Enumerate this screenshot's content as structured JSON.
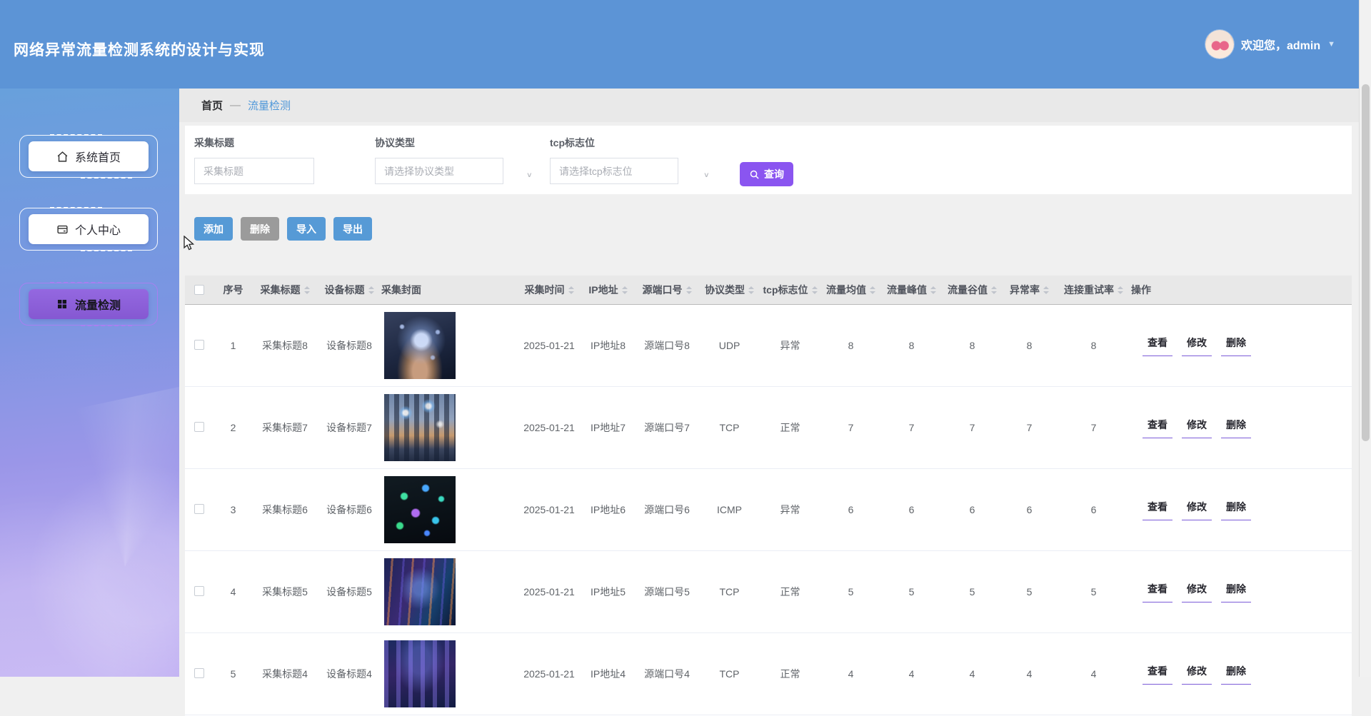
{
  "header": {
    "title": "网络异常流量检测系统的设计与实现",
    "welcome": "欢迎您，admin"
  },
  "sidebar": {
    "items": [
      {
        "label": "系统首页",
        "icon": "home-icon",
        "active": false
      },
      {
        "label": "个人中心",
        "icon": "profile-card-icon",
        "active": false
      },
      {
        "label": "流量检测",
        "icon": "grid-icon",
        "active": true
      }
    ]
  },
  "breadcrumb": {
    "home": "首页",
    "separator": "—",
    "current": "流量检测"
  },
  "filters": {
    "fields": [
      {
        "label": "采集标题",
        "placeholder": "采集标题",
        "type": "input"
      },
      {
        "label": "协议类型",
        "placeholder": "请选择协议类型",
        "type": "select"
      },
      {
        "label": "tcp标志位",
        "placeholder": "请选择tcp标志位",
        "type": "select"
      }
    ],
    "search_label": "查询"
  },
  "toolbar": {
    "add": "添加",
    "delete": "删除",
    "import": "导入",
    "export": "导出"
  },
  "table": {
    "columns": [
      {
        "label": "",
        "type": "checkbox",
        "sortable": false
      },
      {
        "label": "序号",
        "sortable": false
      },
      {
        "label": "采集标题",
        "sortable": true
      },
      {
        "label": "设备标题",
        "sortable": true
      },
      {
        "label": "采集封面",
        "sortable": false
      },
      {
        "label": "采集时间",
        "sortable": true
      },
      {
        "label": "IP地址",
        "sortable": true
      },
      {
        "label": "源端口号",
        "sortable": true
      },
      {
        "label": "协议类型",
        "sortable": true
      },
      {
        "label": "tcp标志位",
        "sortable": true
      },
      {
        "label": "流量均值",
        "sortable": true
      },
      {
        "label": "流量峰值",
        "sortable": true
      },
      {
        "label": "流量谷值",
        "sortable": true
      },
      {
        "label": "异常率",
        "sortable": true
      },
      {
        "label": "连接重试率",
        "sortable": true
      },
      {
        "label": "操作",
        "sortable": false
      }
    ],
    "rows": [
      {
        "index": "1",
        "title": "采集标题8",
        "device": "设备标题8",
        "cover": "hand-network",
        "time": "2025-01-21",
        "ip": "IP地址8",
        "port": "源端口号8",
        "protocol": "UDP",
        "tcp_flag": "异常",
        "avg": "8",
        "peak": "8",
        "valley": "8",
        "anomaly": "8",
        "retry": "8",
        "actions": [
          "查看",
          "修改",
          "删除"
        ]
      },
      {
        "index": "2",
        "title": "采集标题7",
        "device": "设备标题7",
        "cover": "city-network",
        "time": "2025-01-21",
        "ip": "IP地址7",
        "port": "源端口号7",
        "protocol": "TCP",
        "tcp_flag": "正常",
        "avg": "7",
        "peak": "7",
        "valley": "7",
        "anomaly": "7",
        "retry": "7",
        "actions": [
          "查看",
          "修改",
          "删除"
        ]
      },
      {
        "index": "3",
        "title": "采集标题6",
        "device": "设备标题6",
        "cover": "dots-network",
        "time": "2025-01-21",
        "ip": "IP地址6",
        "port": "源端口号6",
        "protocol": "ICMP",
        "tcp_flag": "异常",
        "avg": "6",
        "peak": "6",
        "valley": "6",
        "anomaly": "6",
        "retry": "6",
        "actions": [
          "查看",
          "修改",
          "删除"
        ]
      },
      {
        "index": "4",
        "title": "采集标题5",
        "device": "设备标题5",
        "cover": "neon-street",
        "time": "2025-01-21",
        "ip": "IP地址5",
        "port": "源端口号5",
        "protocol": "TCP",
        "tcp_flag": "正常",
        "avg": "5",
        "peak": "5",
        "valley": "5",
        "anomaly": "5",
        "retry": "5",
        "actions": [
          "查看",
          "修改",
          "删除"
        ]
      },
      {
        "index": "5",
        "title": "采集标题4",
        "device": "设备标题4",
        "cover": "night-city",
        "time": "2025-01-21",
        "ip": "IP地址4",
        "port": "源端口号4",
        "protocol": "TCP",
        "tcp_flag": "正常",
        "avg": "4",
        "peak": "4",
        "valley": "4",
        "anomaly": "4",
        "retry": "4",
        "actions": [
          "查看",
          "修改",
          "删除"
        ]
      }
    ]
  },
  "colors": {
    "header_blue": "#5C94D6",
    "accent_purple": "#8A55F0",
    "button_blue": "#569AD6"
  }
}
